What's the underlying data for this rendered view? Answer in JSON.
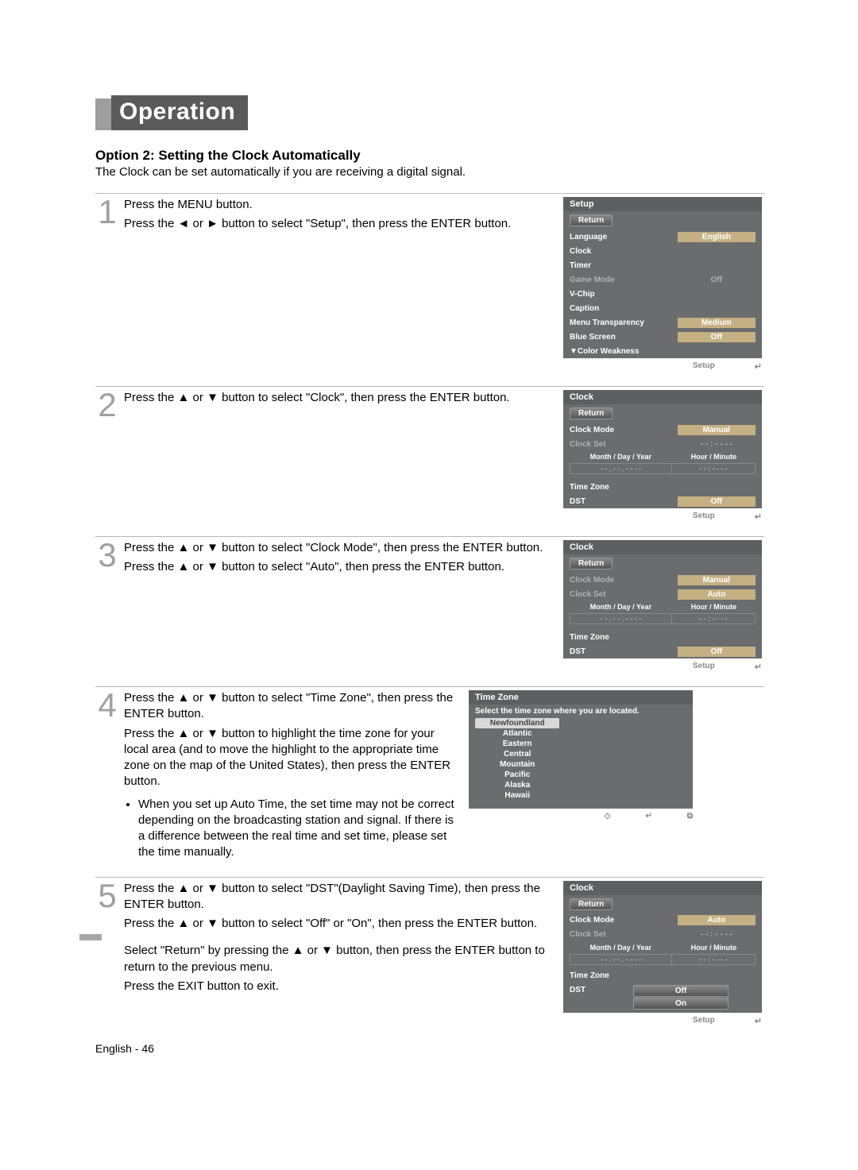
{
  "header": {
    "title": "Operation"
  },
  "section": {
    "subtitle": "Option 2: Setting the Clock Automatically",
    "intro": "The Clock can be set automatically if you are receiving a digital signal."
  },
  "steps": {
    "s1": {
      "num": "1",
      "line1": "Press the MENU button.",
      "line2_pre": "Press the ",
      "line2_mid": " or ",
      "line2_post": " button to select \"Setup\", then press the ENTER button."
    },
    "s2": {
      "num": "2",
      "line1_pre": "Press the ",
      "line1_mid": " or ",
      "line1_post": " button to select \"Clock\", then press the ENTER button."
    },
    "s3": {
      "num": "3",
      "line1_pre": "Press the ",
      "line1_mid": " or ",
      "line1_post": " button to select \"Clock Mode\", then press the ENTER button.",
      "line2_pre": "Press the ",
      "line2_mid": " or ",
      "line2_post": " button to select \"Auto\", then press the ENTER button."
    },
    "s4": {
      "num": "4",
      "line1_pre": "Press the ",
      "line1_mid": " or ",
      "line1_post": " button to select \"Time Zone\", then press the ENTER button.",
      "line2_pre": "Press the ",
      "line2_mid": " or ",
      "line2_post": " button to highlight the time zone for your local area (and to move the highlight to the appropriate time zone on the map of the United States), then press the ENTER button.",
      "bullet": "When you set up Auto Time, the set time may not be correct depending on the broadcasting station and signal. If there is a difference between the real time and set time, please set the time manually."
    },
    "s5": {
      "num": "5",
      "line1_pre": "Press the ",
      "line1_mid": " or ",
      "line1_post": " button to select \"DST\"(Daylight Saving Time), then press the ENTER button.",
      "line2_pre": "Press the ",
      "line2_mid": " or ",
      "line2_post": " button to select \"Off\" or \"On\", then press the ENTER button.",
      "line3_pre": "Select \"Return\" by pressing the ",
      "line3_mid": " or ",
      "line3_post": " button, then press the ENTER button to return to the previous menu.",
      "line4": "Press the EXIT button to exit."
    }
  },
  "osd1": {
    "title": "Setup",
    "ret": "Return",
    "rows": [
      {
        "lab": "Language",
        "val": "English",
        "hl": true
      },
      {
        "lab": "Clock",
        "val": ""
      },
      {
        "lab": "Timer",
        "val": ""
      },
      {
        "lab": "Game Mode",
        "val": "Off",
        "dim": true
      },
      {
        "lab": "V-Chip",
        "val": ""
      },
      {
        "lab": "Caption",
        "val": ""
      },
      {
        "lab": "Menu Transparency",
        "val": "Medium",
        "hl": true
      },
      {
        "lab": "Blue Screen",
        "val": "Off",
        "hl": true
      },
      {
        "lab": "▼Color Weakness",
        "val": ""
      }
    ],
    "footer_setup": "Setup",
    "footer_enter": "↵"
  },
  "osd2": {
    "title": "Clock",
    "ret": "Return",
    "clock_mode_lab": "Clock Mode",
    "clock_mode_val": "Manual",
    "clock_set_lab": "Clock Set",
    "clock_set_val": "- - : - - - -",
    "gh1": "Month / Day / Year",
    "gh2": "Hour / Minute",
    "gr1a": "- -  .  - -  .  - - - -",
    "gr1b": "- - : - -   - -",
    "tz_lab": "Time Zone",
    "dst_lab": "DST",
    "dst_val": "Off",
    "footer_setup": "Setup",
    "footer_enter": "↵"
  },
  "osd3": {
    "title": "Clock",
    "ret": "Return",
    "clock_mode_lab": "Clock Mode",
    "clock_mode_val": "Manual",
    "clock_set_lab": "Clock Set",
    "clock_set_val": "Auto",
    "gh1": "Month / Day / Year",
    "gh2": "Hour / Minute",
    "gr1a": "- -  .  - -  .  - - - -",
    "gr1b": "- - : - -   - -",
    "tz_lab": "Time Zone",
    "dst_lab": "DST",
    "dst_val": "Off",
    "footer_setup": "Setup",
    "footer_enter": "↵"
  },
  "osd4": {
    "title": "Time Zone",
    "sub": "Select the time zone where you are located.",
    "items": [
      "Newfoundland",
      "Atlantic",
      "Eastern",
      "Central",
      "Mountain",
      "Pacific",
      "Alaska",
      "Hawaii"
    ],
    "footer_move": "◇",
    "footer_enter": "↵",
    "footer_return": "⧉"
  },
  "osd5": {
    "title": "Clock",
    "ret": "Return",
    "clock_mode_lab": "Clock Mode",
    "clock_mode_val": "Auto",
    "clock_set_lab": "Clock Set",
    "clock_set_val": "- - : - - - -",
    "gh1": "Month / Day / Year",
    "gh2": "Hour / Minute",
    "gr1a": "- -  .  - -  .  - - - -",
    "gr1b": "- - : - -   - -",
    "tz_lab": "Time Zone",
    "dst_lab": "DST",
    "off": "Off",
    "on": "On",
    "footer_setup": "Setup",
    "footer_enter": "↵"
  },
  "footer": {
    "text": "English - 46"
  },
  "glyphs": {
    "left": "◄",
    "right": "►",
    "up": "▲",
    "down": "▼"
  }
}
